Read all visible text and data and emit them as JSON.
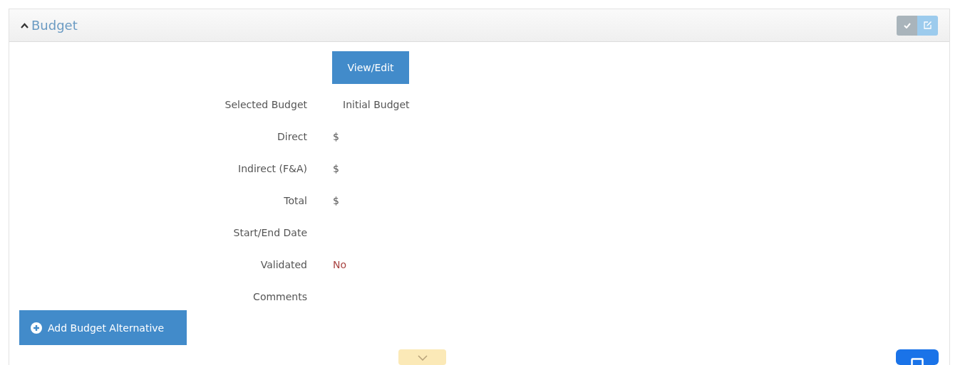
{
  "panel": {
    "title": "Budget",
    "expanded": true
  },
  "primary_button": "View/Edit",
  "fields": [
    {
      "label": "Selected Budget",
      "value": "Initial Budget",
      "color": "#555555"
    },
    {
      "label": "Direct",
      "value": "$",
      "color": "#555555"
    },
    {
      "label": "Indirect (F&A)",
      "value": "$",
      "color": "#555555"
    },
    {
      "label": "Total",
      "value": "$",
      "color": "#555555"
    },
    {
      "label": "Start/End Date"
    },
    {
      "label": "Validated",
      "value": "No",
      "color": "#a94442"
    },
    {
      "label": "Comments"
    }
  ],
  "add_button": "Add Budget Alternative"
}
